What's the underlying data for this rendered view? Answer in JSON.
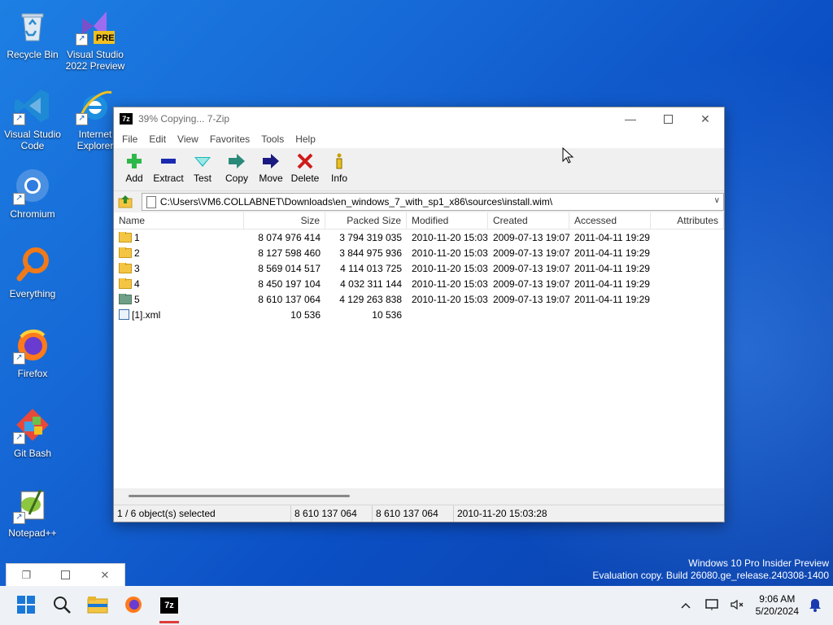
{
  "desktop": {
    "icons": [
      {
        "label": "Recycle Bin",
        "icon": "recycle-bin-icon"
      },
      {
        "label": "Visual Studio 2022 Preview",
        "icon": "visual-studio-preview-icon",
        "badge": "PRE"
      },
      {
        "label": "Visual Studio Code",
        "icon": "vscode-icon"
      },
      {
        "label": "Internet Explorer",
        "icon": "internet-explorer-icon"
      },
      {
        "label": "Chromium",
        "icon": "chromium-icon"
      },
      {
        "label": "Everything",
        "icon": "everything-search-icon"
      },
      {
        "label": "Firefox",
        "icon": "firefox-icon"
      },
      {
        "label": "Git Bash",
        "icon": "git-bash-icon"
      },
      {
        "label": "Notepad++",
        "icon": "notepad-plus-plus-icon"
      }
    ],
    "watermark": {
      "line1": "Windows 10 Pro Insider Preview",
      "line2": "Evaluation copy. Build 26080.ge_release.240308-1400"
    }
  },
  "window": {
    "logo": "7z",
    "title": "39% Copying... 7-Zip",
    "progress_percent": 39,
    "menu": [
      "File",
      "Edit",
      "View",
      "Favorites",
      "Tools",
      "Help"
    ],
    "toolbar": [
      {
        "label": "Add",
        "icon": "add-plus-icon",
        "color": "#2db84a"
      },
      {
        "label": "Extract",
        "icon": "extract-minus-icon",
        "color": "#1a2ab0"
      },
      {
        "label": "Test",
        "icon": "test-check-icon",
        "color": "#1aa7a7"
      },
      {
        "label": "Copy",
        "icon": "copy-arrow-icon",
        "color": "#2a8a7a"
      },
      {
        "label": "Move",
        "icon": "move-arrow-icon",
        "color": "#1a1a80"
      },
      {
        "label": "Delete",
        "icon": "delete-x-icon",
        "color": "#d01a1a"
      },
      {
        "label": "Info",
        "icon": "info-i-icon",
        "color": "#c8a000"
      }
    ],
    "address": "C:\\Users\\VM6.COLLABNET\\Downloads\\en_windows_7_with_sp1_x86\\sources\\install.wim\\",
    "columns": [
      "Name",
      "Size",
      "Packed Size",
      "Modified",
      "Created",
      "Accessed",
      "Attributes"
    ],
    "rows": [
      {
        "name": "1",
        "type": "folder",
        "size": "8 074 976 414",
        "packed": "3 794 319 035",
        "modified": "2010-11-20 15:03",
        "created": "2009-07-13 19:07",
        "accessed": "2011-04-11 19:29",
        "attributes": ""
      },
      {
        "name": "2",
        "type": "folder",
        "size": "8 127 598 460",
        "packed": "3 844 975 936",
        "modified": "2010-11-20 15:03",
        "created": "2009-07-13 19:07",
        "accessed": "2011-04-11 19:29",
        "attributes": ""
      },
      {
        "name": "3",
        "type": "folder",
        "size": "8 569 014 517",
        "packed": "4 114 013 725",
        "modified": "2010-11-20 15:03",
        "created": "2009-07-13 19:07",
        "accessed": "2011-04-11 19:29",
        "attributes": ""
      },
      {
        "name": "4",
        "type": "folder",
        "size": "8 450 197 104",
        "packed": "4 032 311 144",
        "modified": "2010-11-20 15:03",
        "created": "2009-07-13 19:07",
        "accessed": "2011-04-11 19:29",
        "attributes": ""
      },
      {
        "name": "5",
        "type": "folder-selected",
        "size": "8 610 137 064",
        "packed": "4 129 263 838",
        "modified": "2010-11-20 15:03",
        "created": "2009-07-13 19:07",
        "accessed": "2011-04-11 19:29",
        "attributes": ""
      },
      {
        "name": "[1].xml",
        "type": "file",
        "size": "10 536",
        "packed": "10 536",
        "modified": "",
        "created": "",
        "accessed": "",
        "attributes": ""
      }
    ],
    "status": {
      "selection": "1 / 6 object(s) selected",
      "size": "8 610 137 064",
      "packed": "8 610 137 064",
      "modified": "2010-11-20 15:03:28"
    }
  },
  "taskbar": {
    "apps": [
      {
        "name": "start-button",
        "icon": "windows-logo-icon"
      },
      {
        "name": "search-button",
        "icon": "search-icon"
      },
      {
        "name": "file-explorer-button",
        "icon": "folder-icon"
      },
      {
        "name": "firefox-button",
        "icon": "firefox-icon"
      },
      {
        "name": "7zip-button",
        "icon": "7zip-icon",
        "label": "7z"
      }
    ],
    "clock": {
      "time": "9:06 AM",
      "date": "5/20/2024"
    }
  }
}
